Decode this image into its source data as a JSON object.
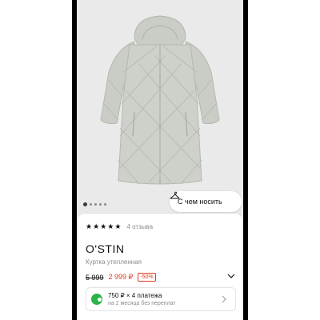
{
  "gallery": {
    "image_alt": "Куртка утепленная",
    "dots_total": 5,
    "dots_active_index": 0,
    "outfit_button_label": "С чем носить",
    "jacket_color": "#c9cdc5"
  },
  "product": {
    "rating_stars": 5,
    "reviews": "4 отзыва",
    "brand": "O'STIN",
    "name": "Куртка утепленная",
    "old_price": "5 999",
    "price": "2 999 ₽",
    "discount": "-50%"
  },
  "installments": {
    "main": "750 ₽ × 4 платежа",
    "sub": "на 2 месяца без переплат"
  },
  "colors": {
    "price_red": "#e03a1c",
    "split_green": "#2bb34a"
  }
}
